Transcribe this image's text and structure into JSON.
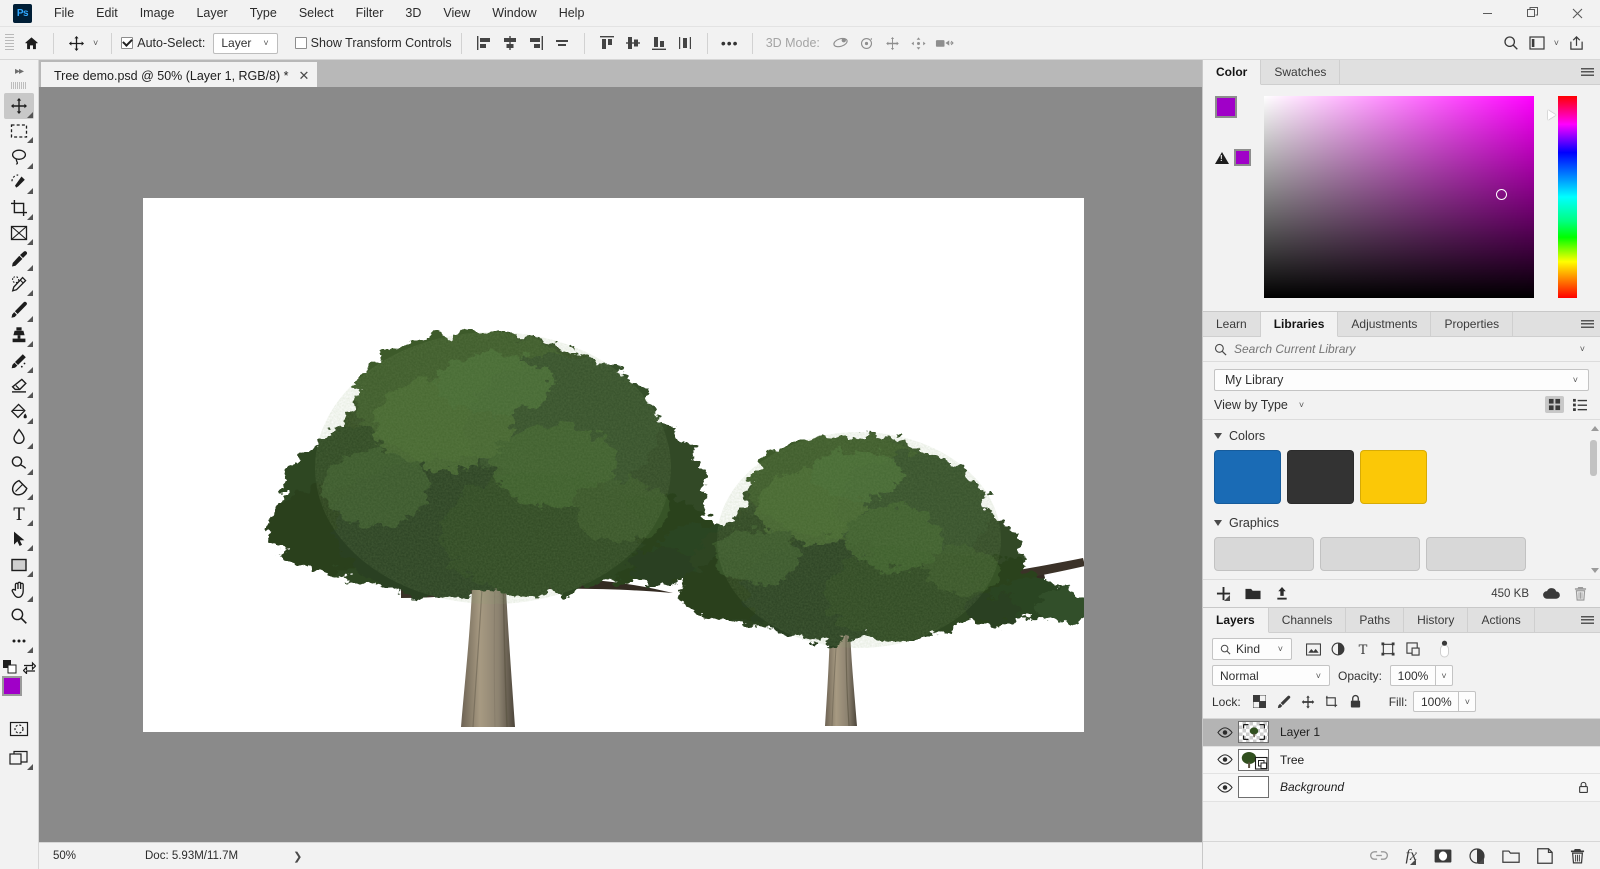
{
  "app": {
    "logo_text": "Ps",
    "window_controls": {
      "minimize": "minimize-icon",
      "maximize": "maximize-icon",
      "close": "close-icon"
    }
  },
  "menubar": {
    "items": [
      "File",
      "Edit",
      "Image",
      "Layer",
      "Type",
      "Select",
      "Filter",
      "3D",
      "View",
      "Window",
      "Help"
    ]
  },
  "options_bar": {
    "home_icon": "home-icon",
    "tool_icon": "move-tool-icon",
    "auto_select_label": "Auto-Select:",
    "auto_select_checked": true,
    "auto_select_target": "Layer",
    "show_transform_label": "Show Transform Controls",
    "show_transform_checked": false,
    "mode_3d_label": "3D Mode:",
    "more_label": "•••",
    "right_icons": [
      "search-icon",
      "workspace-icon",
      "chevron-down-icon",
      "share-icon"
    ]
  },
  "toolbar": {
    "tools": [
      {
        "name": "move-tool",
        "active": true
      },
      {
        "name": "rectangular-marquee-tool",
        "active": false
      },
      {
        "name": "lasso-tool",
        "active": false
      },
      {
        "name": "quick-selection-tool",
        "active": false
      },
      {
        "name": "crop-tool",
        "active": false
      },
      {
        "name": "frame-tool",
        "active": false
      },
      {
        "name": "eyedropper-tool",
        "active": false
      },
      {
        "name": "spot-healing-brush-tool",
        "active": false
      },
      {
        "name": "brush-tool",
        "active": false
      },
      {
        "name": "clone-stamp-tool",
        "active": false
      },
      {
        "name": "history-brush-tool",
        "active": false
      },
      {
        "name": "eraser-tool",
        "active": false
      },
      {
        "name": "gradient-tool",
        "active": false
      },
      {
        "name": "blur-tool",
        "active": false
      },
      {
        "name": "dodge-tool",
        "active": false
      },
      {
        "name": "pen-tool",
        "active": false
      },
      {
        "name": "horizontal-type-tool",
        "active": false
      },
      {
        "name": "path-selection-tool",
        "active": false
      },
      {
        "name": "rectangle-tool",
        "active": false
      },
      {
        "name": "hand-tool",
        "active": false
      },
      {
        "name": "zoom-tool",
        "active": false
      },
      {
        "name": "edit-toolbar-tool",
        "active": false
      }
    ],
    "foreground_color": "#a000c8",
    "background_color": "#ffffff",
    "quick_mask_icon": "quick-mask-icon",
    "screen_mode_icon": "screen-mode-icon"
  },
  "document": {
    "tab_title": "Tree demo.psd @ 50% (Layer 1, RGB/8) *",
    "close_icon": "close-icon"
  },
  "status_bar": {
    "zoom": "50%",
    "doc_info": "Doc: 5.93M/11.7M",
    "expand_icon": "chevron-right-icon"
  },
  "color_panel": {
    "tabs": [
      {
        "label": "Color",
        "active": true
      },
      {
        "label": "Swatches",
        "active": false
      }
    ],
    "menu_icon": "panel-menu-icon",
    "foreground": "#a000c8",
    "background": "#ffffff",
    "out_of_gamut_swatch": "#a000c8",
    "warning_icon": "gamut-warning-icon"
  },
  "libraries_panel": {
    "tabs": [
      {
        "label": "Learn",
        "active": false
      },
      {
        "label": "Libraries",
        "active": true
      },
      {
        "label": "Adjustments",
        "active": false
      },
      {
        "label": "Properties",
        "active": false
      }
    ],
    "menu_icon": "panel-menu-icon",
    "search_placeholder": "Search Current Library",
    "search_value": "",
    "library_selected": "My Library",
    "view_by": "View by Type",
    "groups": [
      {
        "title": "Colors",
        "type": "colors",
        "items": [
          "#1a6bb5",
          "#333333",
          "#fbc807"
        ]
      },
      {
        "title": "Graphics",
        "type": "graphics",
        "items": [
          "",
          "",
          ""
        ]
      }
    ],
    "footer": {
      "add_icon": "add-content-icon",
      "folder_icon": "new-group-icon",
      "upload_icon": "upload-icon",
      "size_label": "450 KB",
      "cloud_icon": "cloud-sync-icon",
      "delete_icon": "trash-icon"
    }
  },
  "layers_panel": {
    "tabs": [
      {
        "label": "Layers",
        "active": true
      },
      {
        "label": "Channels",
        "active": false
      },
      {
        "label": "Paths",
        "active": false
      },
      {
        "label": "History",
        "active": false
      },
      {
        "label": "Actions",
        "active": false
      }
    ],
    "menu_icon": "panel-menu-icon",
    "filter_kind": "Kind",
    "filter_icons": [
      "filter-pixel-icon",
      "filter-adjustment-icon",
      "filter-type-icon",
      "filter-shape-icon",
      "filter-smart-object-icon"
    ],
    "filter_toggle_icon": "filter-toggle-icon",
    "blend_mode": "Normal",
    "opacity_label": "Opacity:",
    "opacity_value": "100%",
    "lock_label": "Lock:",
    "lock_icons": [
      "lock-transparent-pixels-icon",
      "lock-image-pixels-icon",
      "lock-position-icon",
      "lock-artboard-icon",
      "lock-all-icon"
    ],
    "fill_label": "Fill:",
    "fill_value": "100%",
    "layers": [
      {
        "name": "Layer 1",
        "visible": true,
        "selected": true,
        "thumb": "transparent-tree",
        "italic": false,
        "locked": false
      },
      {
        "name": "Tree",
        "visible": true,
        "selected": false,
        "thumb": "tree-smart-object",
        "italic": false,
        "locked": false
      },
      {
        "name": "Background",
        "visible": true,
        "selected": false,
        "thumb": "white",
        "italic": true,
        "locked": true
      }
    ],
    "footer_icons": [
      "link-layers-icon",
      "add-layer-style-icon",
      "add-layer-mask-icon",
      "new-fill-adjustment-icon",
      "new-group-icon",
      "new-layer-icon",
      "delete-layer-icon"
    ],
    "footer_fx_label": "fx"
  },
  "canvas": {
    "background_color": "#8a8a8a",
    "artboard_color": "#ffffff",
    "content_description": "two-trees-on-white-background",
    "trees": [
      {
        "name": "large-tree",
        "trunk_color": "#9c8f78",
        "canopy_color": "#2e4a24"
      },
      {
        "name": "small-tree",
        "trunk_color": "#9c8f78",
        "canopy_color": "#2e4a24"
      }
    ]
  }
}
